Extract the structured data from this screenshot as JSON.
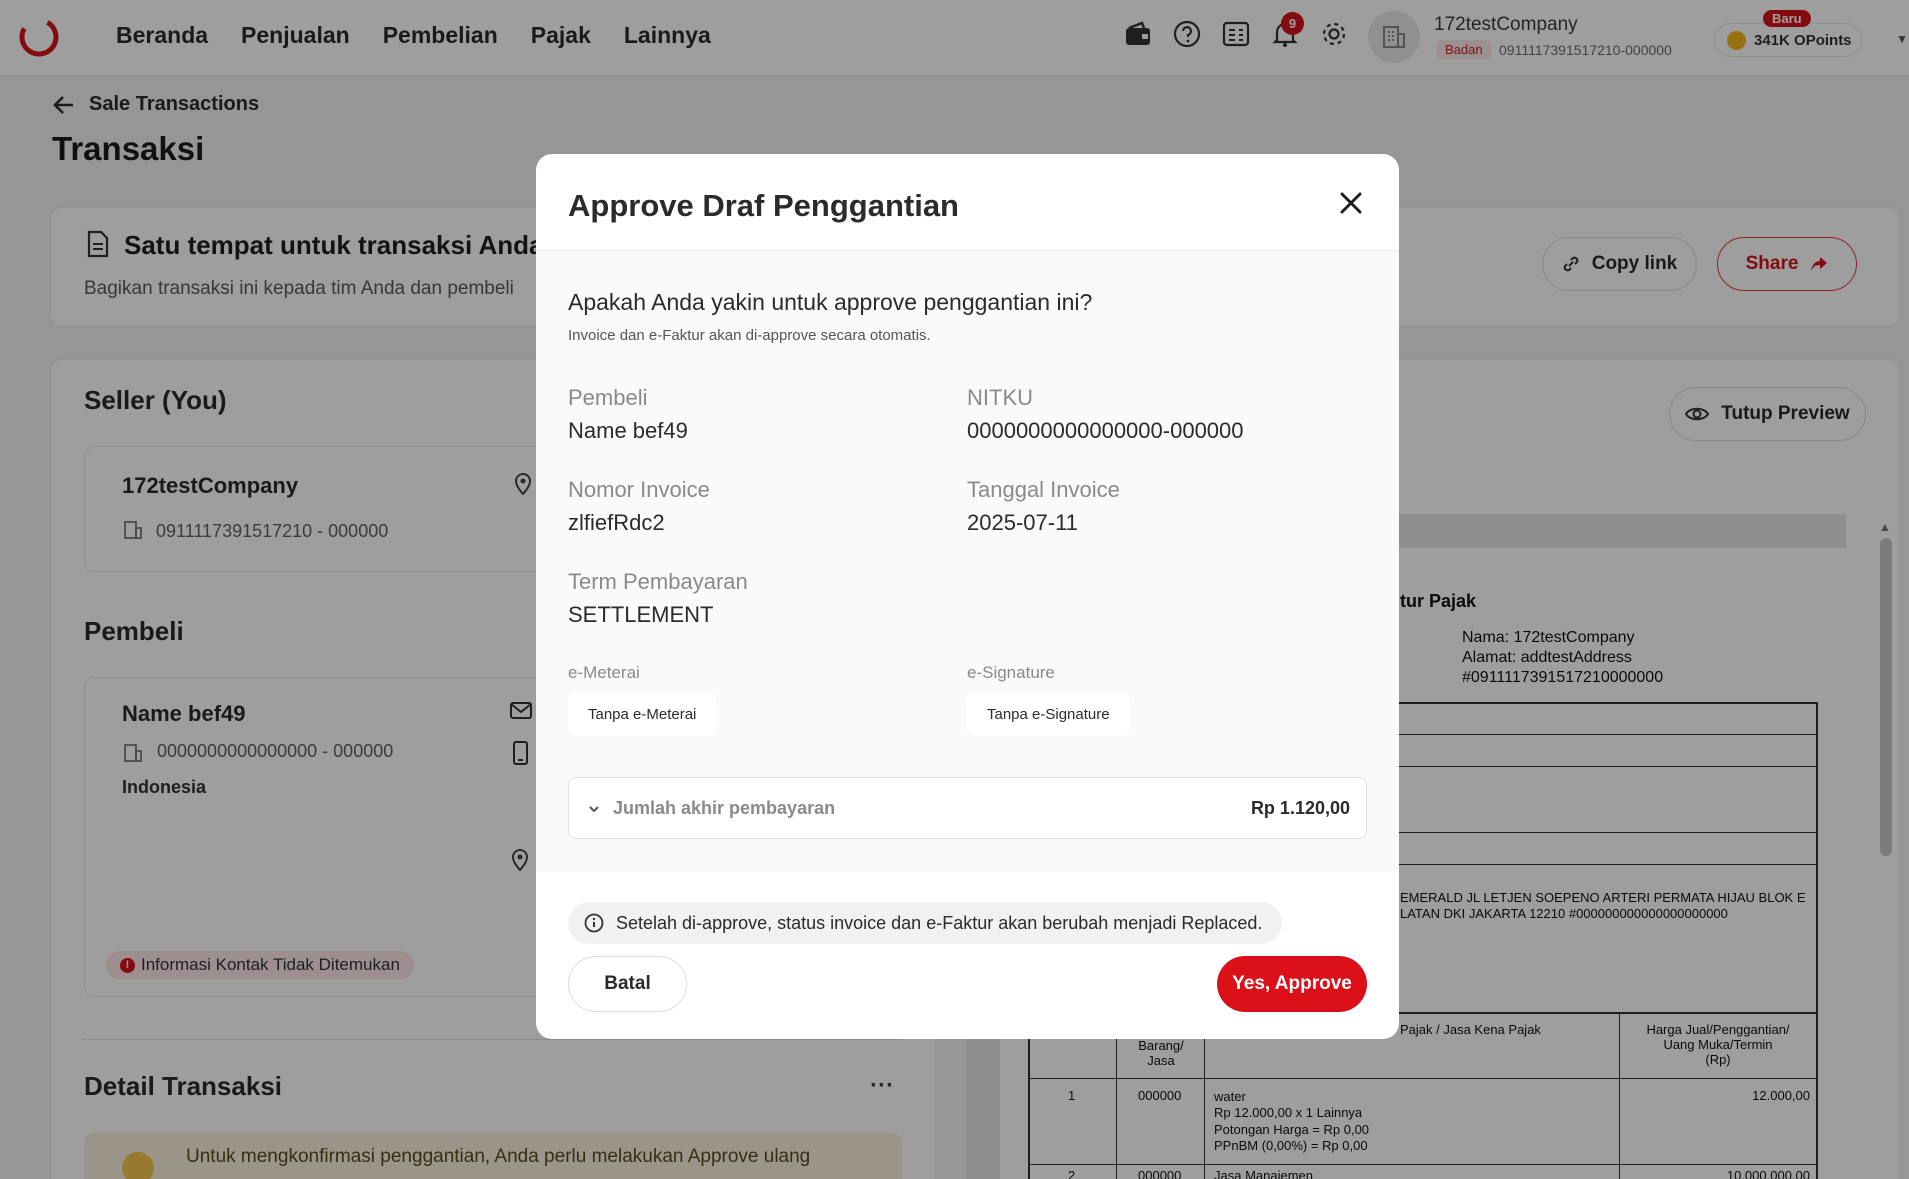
{
  "nav": {
    "items": [
      "Beranda",
      "Penjualan",
      "Pembelian",
      "Pajak",
      "Lainnya"
    ],
    "notification_count": "9",
    "icons": [
      "wallet-icon",
      "help-icon",
      "invoice-icon",
      "bell-icon",
      "gear-icon"
    ]
  },
  "company": {
    "name": "172testCompany",
    "tag": "Badan",
    "npwp": "0911117391517210-000000"
  },
  "points": {
    "badge": "Baru",
    "label": "341K OPoints"
  },
  "page": {
    "back_label": "Sale Transactions",
    "title": "Transaksi"
  },
  "banner": {
    "title": "Satu tempat untuk transaksi Anda",
    "subtitle": "Bagikan transaksi ini kepada tim Anda dan pembeli",
    "copy_link": "Copy link",
    "share": "Share"
  },
  "seller": {
    "section": "Seller (You)",
    "name": "172testCompany",
    "npwp": "0911117391517210 - 000000"
  },
  "buyer": {
    "section": "Pembeli",
    "name": "Name bef49",
    "npwp": "0000000000000000 - 000000",
    "country": "Indonesia",
    "warning": "Informasi Kontak Tidak Ditemukan"
  },
  "detail": {
    "section": "Detail Transaksi",
    "notice": "Untuk mengkonfirmasi penggantian, Anda perlu melakukan Approve ulang"
  },
  "preview": {
    "toggle": "Tutup Preview",
    "doc_title": "tur Pajak",
    "seller_name": "Nama: 172testCompany",
    "seller_address": "Alamat: addtestAddress",
    "seller_id": "#0911117391517210000000",
    "buyer_address_1": "EMERALD JL LETJEN SOEPENO ARTERI PERMATA HIJAU BLOK E",
    "buyer_address_2": "LATAN DKI JAKARTA 12210 #000000000000000000000",
    "col_code": "Barang/\nJasa",
    "col_name": "Pajak / Jasa Kena Pajak",
    "col_price": "Harga Jual/Penggantian/\nUang Muka/Termin\n(Rp)",
    "rows": [
      {
        "no": "1",
        "code": "000000",
        "desc": [
          "water",
          "Rp 12.000,00 x 1 Lainnya",
          "Potongan Harga = Rp 0,00",
          "PPnBM (0,00%) = Rp 0,00"
        ],
        "price": "12.000,00"
      },
      {
        "no": "2",
        "code": "000000",
        "desc": [
          "Jasa Manajemen"
        ],
        "price": "10.000.000,00"
      }
    ]
  },
  "modal": {
    "title": "Approve Draf Penggantian",
    "question": "Apakah Anda yakin untuk approve penggantian ini?",
    "question_sub": "Invoice dan e-Faktur akan di-approve secara otomatis.",
    "fields": {
      "pembeli_label": "Pembeli",
      "pembeli_value": "Name bef49",
      "nitku_label": "NITKU",
      "nitku_value": "0000000000000000-000000",
      "invoice_label": "Nomor Invoice",
      "invoice_value": "zlfiefRdc2",
      "date_label": "Tanggal Invoice",
      "date_value": "2025-07-11",
      "term_label": "Term Pembayaran",
      "term_value": "SETTLEMENT",
      "meterai_label": "e-Meterai",
      "meterai_value": "Tanpa e-Meterai",
      "signature_label": "e-Signature",
      "signature_value": "Tanpa e-Signature"
    },
    "total_label": "Jumlah akhir pembayaran",
    "total_value": "Rp 1.120,00",
    "info": "Setelah di-approve, status invoice dan e-Faktur akan berubah menjadi Replaced.",
    "cancel": "Batal",
    "confirm": "Yes, Approve"
  },
  "colors": {
    "brand_red": "#dc1019",
    "overlay": "rgba(0,0,0,0.38)"
  }
}
